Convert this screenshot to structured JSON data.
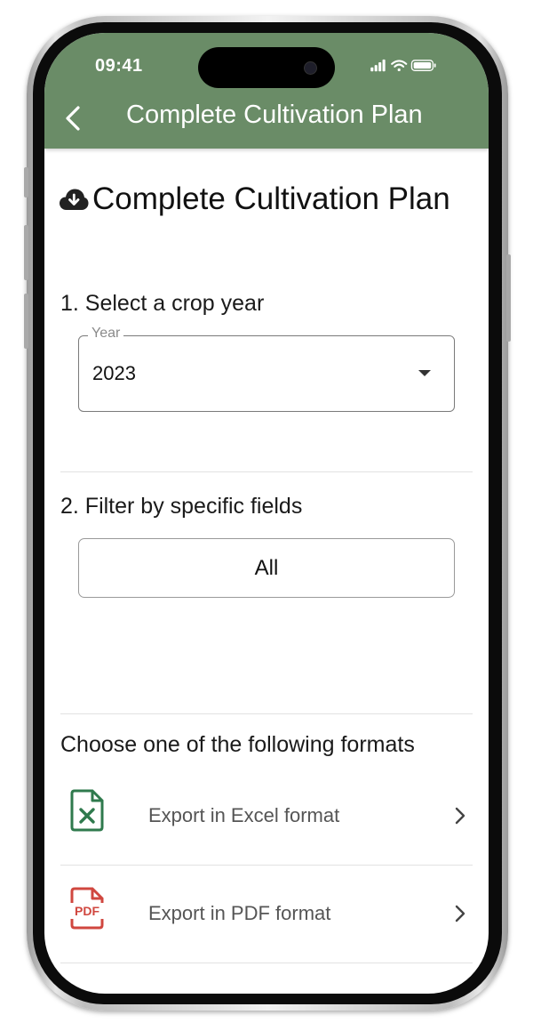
{
  "status_bar": {
    "time": "09:41"
  },
  "header": {
    "title": "Complete Cultivation Plan"
  },
  "page": {
    "title": "Complete Cultivation Plan",
    "title_icon": "cloud-download-icon"
  },
  "step1": {
    "label": "1. Select a crop year",
    "select": {
      "legend": "Year",
      "value": "2023"
    }
  },
  "step2": {
    "label": "2. Filter by specific fields",
    "button_label": "All"
  },
  "formats": {
    "label": "Choose one of the following formats",
    "items": [
      {
        "label": "Export in Excel format",
        "icon": "excel-file-icon",
        "color": "#2f7a4d"
      },
      {
        "label": "Export in PDF format",
        "icon": "pdf-file-icon",
        "color": "#d0473f"
      }
    ]
  },
  "colors": {
    "header": "#6a8c67",
    "excel": "#2f7a4d",
    "pdf": "#d0473f"
  }
}
